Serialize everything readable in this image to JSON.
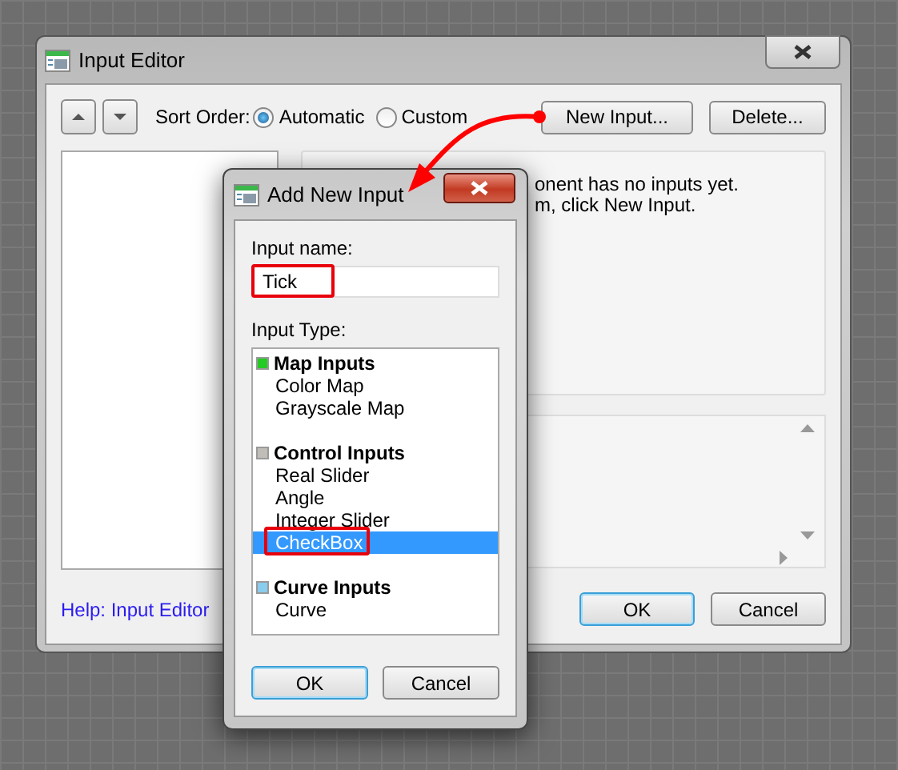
{
  "window": {
    "title": "Input Editor"
  },
  "sort_order": {
    "label": "Sort Order:",
    "options": [
      {
        "label": "Automatic",
        "selected": true
      },
      {
        "label": "Custom",
        "selected": false
      }
    ]
  },
  "toolbar_buttons": [
    "New Input...",
    "Delete..."
  ],
  "info_text": [
    "onent has no inputs yet.",
    "m, click New Input."
  ],
  "help_link": "Help: Input Editor",
  "buttons": [
    {
      "label": "OK",
      "default": true
    },
    {
      "label": "Cancel",
      "default": false
    }
  ],
  "dialog": {
    "title": "Add New Input",
    "name_label": "Input name:",
    "name_value": "Tick",
    "type_label": "Input Type:",
    "groups": [
      {
        "name": "Map Inputs",
        "color": "#22cc22",
        "items": [
          {
            "label": "Color Map",
            "selected": false
          },
          {
            "label": "Grayscale Map",
            "selected": false
          }
        ]
      },
      {
        "name": "Control Inputs",
        "color": "#c0bdb8",
        "items": [
          {
            "label": "Real Slider",
            "selected": false
          },
          {
            "label": "Angle",
            "selected": false
          },
          {
            "label": "Integer Slider",
            "selected": false
          },
          {
            "label": "CheckBox",
            "selected": true
          }
        ]
      },
      {
        "name": "Curve Inputs",
        "color": "#88ccee",
        "items": [
          {
            "label": "Curve",
            "selected": false
          }
        ]
      }
    ],
    "buttons": [
      {
        "label": "OK",
        "default": true
      },
      {
        "label": "Cancel",
        "default": false
      }
    ]
  }
}
